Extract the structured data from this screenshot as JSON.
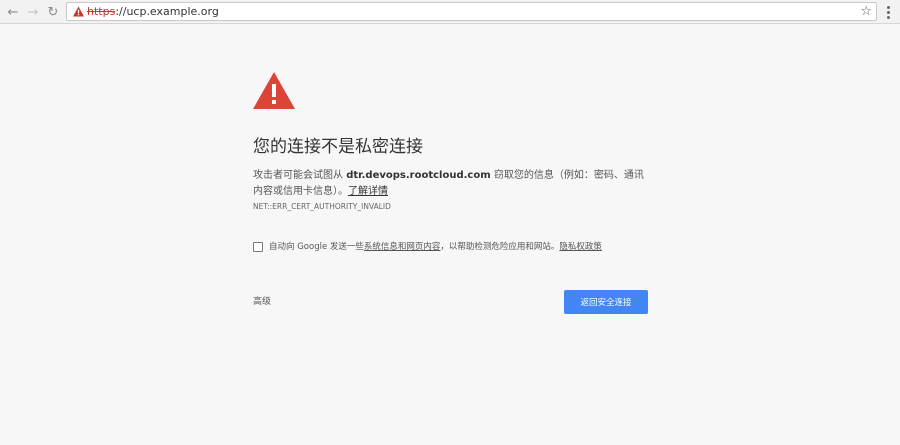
{
  "browser": {
    "url_scheme": "https",
    "url_separator": "://",
    "url_host": "ucp.example.org",
    "icons": {
      "back": "arrow-left-icon",
      "forward": "arrow-right-icon",
      "reload": "reload-icon",
      "security": "warning-triangle-icon",
      "bookmark": "star-icon",
      "menu": "vertical-dots-icon"
    }
  },
  "interstitial": {
    "title": "您的连接不是私密连接",
    "description_prefix": "攻击者可能会试图从",
    "domain": "dtr.devops.rootcloud.com",
    "description_middle": "窃取您的信息（例如：密码、通讯内容或信用卡信息）。",
    "learn_more": "了解详情",
    "error_code": "NET::ERR_CERT_AUTHORITY_INVALID",
    "optin": {
      "text_before": "自动向 Google 发送一些",
      "link1": "系统信息和网页内容",
      "text_middle": "，以帮助检测危险应用和网站。",
      "link2": "隐私权政策",
      "checked": false
    },
    "advanced_label": "高级",
    "back_button_label": "返回安全连接",
    "colors": {
      "warning": "#db4437",
      "button": "#4285f4",
      "background": "#f7f7f7",
      "url_scheme": "#c53929"
    }
  }
}
